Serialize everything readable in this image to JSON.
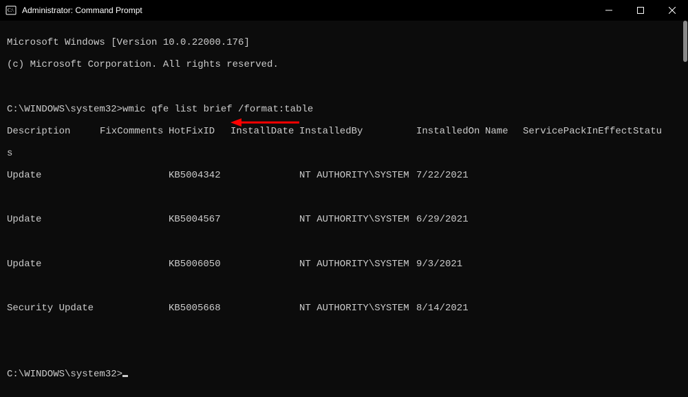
{
  "window": {
    "title": "Administrator: Command Prompt"
  },
  "banner": {
    "line1": "Microsoft Windows [Version 10.0.22000.176]",
    "line2": "(c) Microsoft Corporation. All rights reserved."
  },
  "prompt1": "C:\\WINDOWS\\system32>",
  "command": "wmic qfe list brief /format:table",
  "headers": {
    "description": "Description",
    "fixcomments": "FixComments",
    "hotfixid": "HotFixID",
    "installdate": "InstallDate",
    "installedby": "InstalledBy",
    "installedon": "InstalledOn",
    "name": "Name",
    "servicepack": "ServicePackInEffect",
    "status": "Statu",
    "status_wrap": "s"
  },
  "rows": [
    {
      "description": "Update",
      "hotfixid": "KB5004342",
      "installedby": "NT AUTHORITY\\SYSTEM",
      "installedon": "7/22/2021"
    },
    {
      "description": "Update",
      "hotfixid": "KB5004567",
      "installedby": "NT AUTHORITY\\SYSTEM",
      "installedon": "6/29/2021"
    },
    {
      "description": "Update",
      "hotfixid": "KB5006050",
      "installedby": "NT AUTHORITY\\SYSTEM",
      "installedon": "9/3/2021"
    },
    {
      "description": "Security Update",
      "hotfixid": "KB5005668",
      "installedby": "NT AUTHORITY\\SYSTEM",
      "installedon": "8/14/2021"
    }
  ],
  "prompt2": "C:\\WINDOWS\\system32>",
  "annotation": {
    "target_hotfix": "KB5004567",
    "arrow_color": "#ff0000"
  }
}
